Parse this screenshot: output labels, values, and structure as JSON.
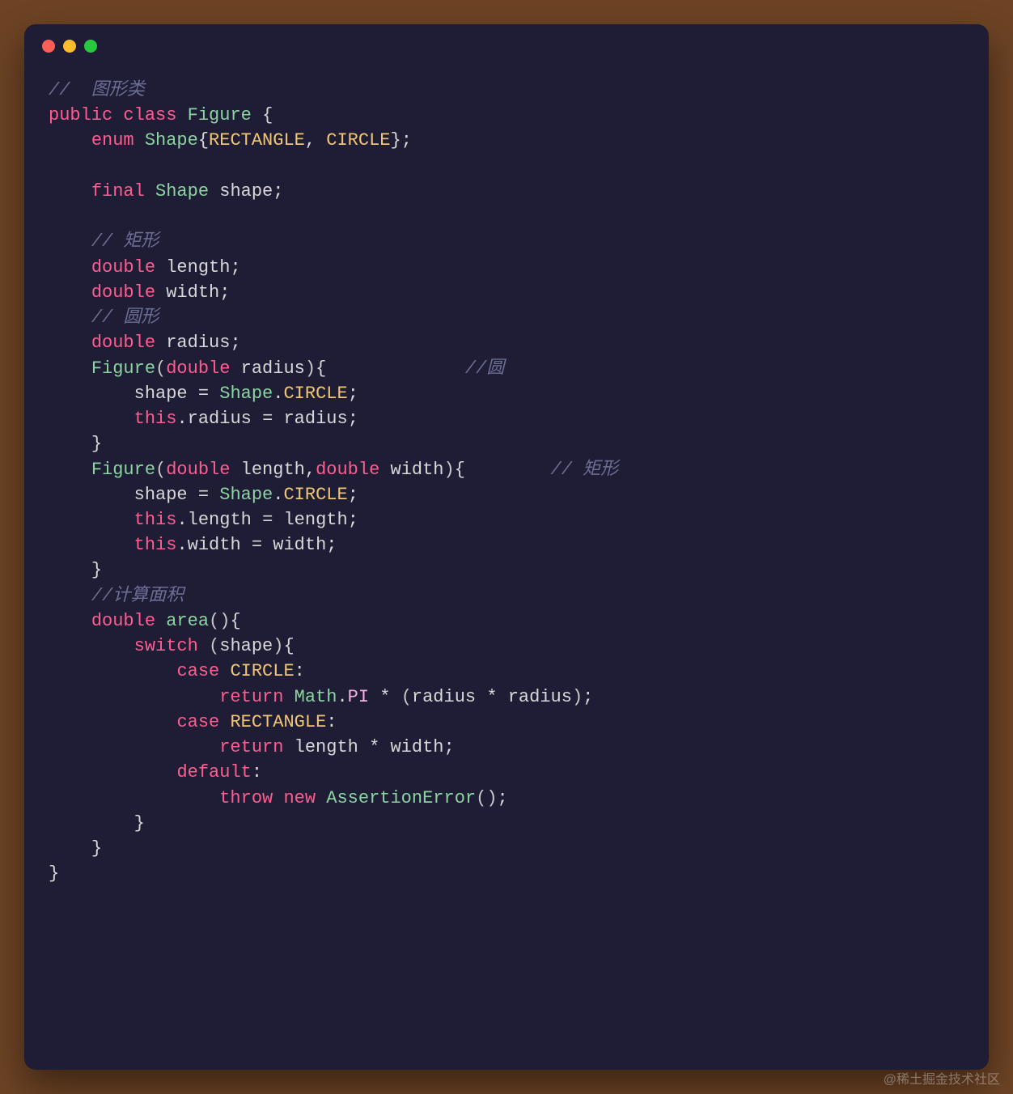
{
  "window": {
    "traffic": {
      "red": "#ff5f56",
      "yellow": "#ffbd2e",
      "green": "#27c93f"
    }
  },
  "watermark": "@稀土掘金技术社区",
  "code": {
    "c01": "//  图形类",
    "l02_public": "public",
    "l02_class": "class",
    "l02_Figure": "Figure",
    "l02_ob": "{",
    "l03_enum": "enum",
    "l03_Shape": "Shape",
    "l03_ob": "{",
    "l03_RECT": "RECTANGLE",
    "l03_comma": ",",
    "l03_CIRC": "CIRCLE",
    "l03_cb": "}",
    "l03_semi": ";",
    "l05_final": "final",
    "l05_Shape": "Shape",
    "l05_shape": "shape",
    "l05_semi": ";",
    "c07": "// 矩形",
    "l08_double": "double",
    "l08_length": "length",
    "l08_semi": ";",
    "l09_double": "double",
    "l09_width": "width",
    "l09_semi": ";",
    "c10": "// 圆形",
    "l11_double": "double",
    "l11_radius": "radius",
    "l11_semi": ";",
    "l12_Figure": "Figure",
    "l12_op": "(",
    "l12_double": "double",
    "l12_radius": "radius",
    "l12_cp": ")",
    "l12_ob": "{",
    "c12": "//圆",
    "l13_shape": "shape",
    "l13_eq": "=",
    "l13_Shape": "Shape",
    "l13_dot": ".",
    "l13_CIRC": "CIRCLE",
    "l13_semi": ";",
    "l14_this": "this",
    "l14_dot": ".",
    "l14_radius1": "radius",
    "l14_eq": "=",
    "l14_radius2": "radius",
    "l14_semi": ";",
    "l15_cb": "}",
    "l16_Figure": "Figure",
    "l16_op": "(",
    "l16_double1": "double",
    "l16_length": "length",
    "l16_comma": ",",
    "l16_double2": "double",
    "l16_width": "width",
    "l16_cp": ")",
    "l16_ob": "{",
    "c16": "// 矩形",
    "l17_shape": "shape",
    "l17_eq": "=",
    "l17_Shape": "Shape",
    "l17_dot": ".",
    "l17_CIRC": "CIRCLE",
    "l17_semi": ";",
    "l18_this": "this",
    "l18_dot": ".",
    "l18_length1": "length",
    "l18_eq": "=",
    "l18_length2": "length",
    "l18_semi": ";",
    "l19_this": "this",
    "l19_dot": ".",
    "l19_width1": "width",
    "l19_eq": "=",
    "l19_width2": "width",
    "l19_semi": ";",
    "l20_cb": "}",
    "c21": "//计算面积",
    "l22_double": "double",
    "l22_area": "area",
    "l22_op": "(",
    "l22_cp": ")",
    "l22_ob": "{",
    "l23_switch": "switch",
    "l23_op": "(",
    "l23_shape": "shape",
    "l23_cp": ")",
    "l23_ob": "{",
    "l24_case": "case",
    "l24_CIRC": "CIRCLE",
    "l24_colon": ":",
    "l25_return": "return",
    "l25_Math": "Math",
    "l25_dot": ".",
    "l25_PI": "PI",
    "l25_mul": "*",
    "l25_op": "(",
    "l25_radius1": "radius",
    "l25_mul2": "*",
    "l25_radius2": "radius",
    "l25_cp": ")",
    "l25_semi": ";",
    "l26_case": "case",
    "l26_RECT": "RECTANGLE",
    "l26_colon": ":",
    "l27_return": "return",
    "l27_length": "length",
    "l27_mul": "*",
    "l27_width": "width",
    "l27_semi": ";",
    "l28_default": "default",
    "l28_colon": ":",
    "l29_throw": "throw",
    "l29_new": "new",
    "l29_AE": "AssertionError",
    "l29_op": "(",
    "l29_cp": ")",
    "l29_semi": ";",
    "l30_cb": "}",
    "l31_cb": "}",
    "l32_cb": "}"
  }
}
